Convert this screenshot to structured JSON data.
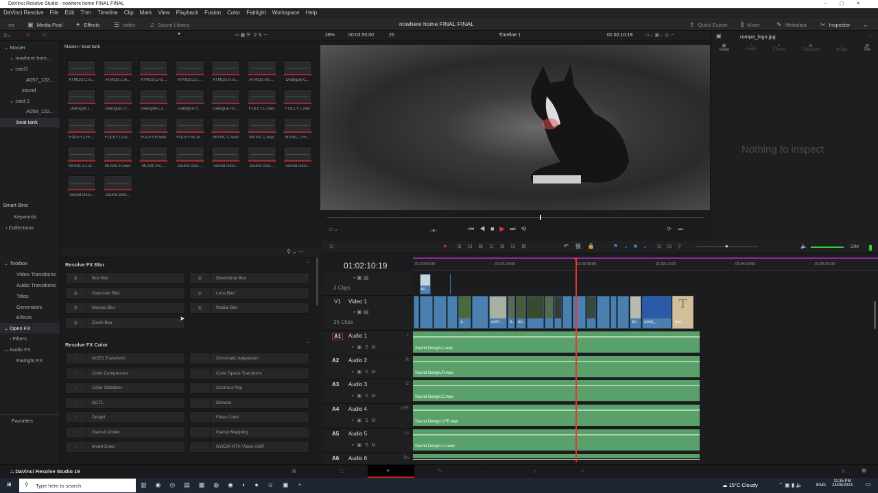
{
  "window": {
    "title": "DaVinci Resolve Studio - nowhere home FINAL FINAL"
  },
  "menu": [
    "DaVinci Resolve",
    "File",
    "Edit",
    "Trim",
    "Timeline",
    "Clip",
    "Mark",
    "View",
    "Playback",
    "Fusion",
    "Color",
    "Fairlight",
    "Workspace",
    "Help"
  ],
  "toolbar": {
    "media_pool": "Media Pool",
    "effects": "Effects",
    "index": "Index",
    "sound_library": "Sound Library",
    "project_title": "nowhere home FINAL FINAL",
    "quick_export": "Quick Export",
    "mixer": "Mixer",
    "metadata": "Metadata",
    "inspector": "Inspector"
  },
  "viewer": {
    "zoom": "28%",
    "duration": "00:03:50:00",
    "fps": "25",
    "timeline_name": "Timeline 1",
    "timecode": "01:02:10:19"
  },
  "bins": {
    "master": "Master",
    "items": [
      "nowhere hom...",
      "card1",
      "A057_122...",
      "sound",
      "card 2",
      "A058_122...",
      "beat tank"
    ],
    "smart_bins": "Smart Bins",
    "keywords": "Keywords",
    "collections": "Collections"
  },
  "pool": {
    "breadcrumb": "Master / beat tank",
    "clips": [
      "ATMOS.C.w...",
      "ATMOS.L.w...",
      "ATMOS.LFE...",
      "ATMOS.Ls....",
      "ATMOS.R.w...",
      "ATMOS.Rs....",
      "Dialogue.C...",
      "Dialogue.L...",
      "Dialogue.LF...",
      "Dialogue.Ls...",
      "Dialogue.R...",
      "Dialogue.Rs...",
      "FOLEY.C.wav",
      "FOLEY.L.wav",
      "FOLEY.LFE...",
      "FOLEY.Ls.w...",
      "FOLEY.R.wav",
      "FOLEY.Rs.w...",
      "MUSIC.C.wav",
      "MUSIC.L.wav",
      "MUSIC.LFE...",
      "MUSIC.Ls.w...",
      "MUSIC.R.wav",
      "MUSIC.Rs....",
      "Sound Desi...",
      "Sound Desi...",
      "Sound Desi...",
      "Sound Desi...",
      "Sound Desi...",
      "Sound Desi..."
    ]
  },
  "inspector": {
    "file": "rompa_logo.jpg",
    "tabs": [
      "Video",
      "Audio",
      "Effects",
      "Transition",
      "Image",
      "File"
    ],
    "empty": "Nothing to inspect"
  },
  "fx_side": {
    "toolbox": "Toolbox",
    "items": [
      "Video Transitions",
      "Audio Transitions",
      "Titles",
      "Generators",
      "Effects"
    ],
    "open_fx": "Open FX",
    "filters": "Filters",
    "audio_fx": "Audio FX",
    "fairlight_fx": "Fairlight FX",
    "favorites": "Favorites"
  },
  "fx": {
    "blur_title": "Resolve FX Blur",
    "blur": [
      "Box Blur",
      "Directional Blur",
      "Gaussian Blur",
      "Lens Blur",
      "Mosaic Blur",
      "Radial Blur",
      "Zoom Blur"
    ],
    "color_title": "Resolve FX Color",
    "color": [
      "ACES Transform",
      "Chromatic Adaptation",
      "Color Compressor",
      "Color Space Transform",
      "Color Stabilizer",
      "Contrast Pop",
      "DCTL",
      "Dehaze",
      "Despill",
      "False Color",
      "Gamut Limiter",
      "Gamut Mapping",
      "Invert Color",
      "NVIDIA RTX Video HDR"
    ]
  },
  "timeline": {
    "timecode": "01:02:10:19",
    "ruler": [
      "01:00:00:00",
      "01:01:04:00",
      "01:02:08:00",
      "01:03:12:00",
      "01:04:16:00",
      "01:05:20:00"
    ],
    "v2": {
      "clips": "3 Clips",
      "clip_label": "A0..."
    },
    "v1": {
      "id": "V1",
      "name": "Video 1",
      "clips": "35 Clips",
      "labels": [
        "A...",
        "A057...",
        "A...",
        "A0...",
        "A0...",
        "A058_...",
        "Text - ..."
      ]
    },
    "audio": [
      {
        "id": "A1",
        "name": "Audio 1",
        "ch": "L",
        "clip": "Sound Design.L.wav"
      },
      {
        "id": "A2",
        "name": "Audio 2",
        "ch": "R",
        "clip": "Sound Design.R.wav"
      },
      {
        "id": "A3",
        "name": "Audio 3",
        "ch": "C",
        "clip": "Sound Design.C.wav"
      },
      {
        "id": "A4",
        "name": "Audio 4",
        "ch": "LFE",
        "clip": "Sound Design.LFE.wav"
      },
      {
        "id": "A5",
        "name": "Audio 5",
        "ch": "Ls",
        "clip": "Sound Design.Ls.wav"
      },
      {
        "id": "A6",
        "name": "Audio 6",
        "ch": "Rs",
        "clip": ""
      }
    ],
    "s": "S",
    "m": "M",
    "dim": "DIM"
  },
  "pagebar": {
    "app": "DaVinci Resolve Studio 19"
  },
  "taskbar": {
    "search": "Type here to search",
    "weather": "15°C  Cloudy",
    "lang": "ENG",
    "time": "11:35 PM",
    "date": "24/09/2024"
  }
}
